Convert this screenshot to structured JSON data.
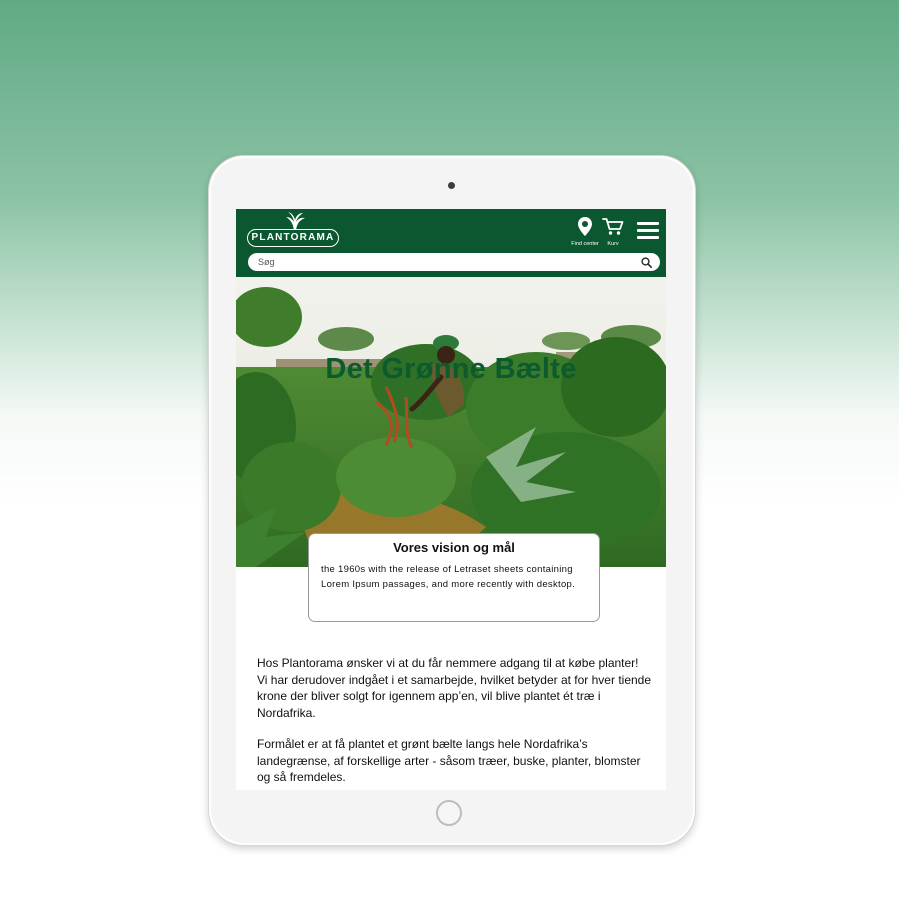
{
  "app": {
    "logo_text": "PLANTORAMA"
  },
  "header": {
    "find_center_label": "Find center",
    "cart_label": "Kurv",
    "search_placeholder": "Søg"
  },
  "hero": {
    "title": "Det Grønne Bælte"
  },
  "vision_card": {
    "title": "Vores vision og mål",
    "text": "the 1960s with the release of Letraset sheets containing Lorem Ipsum passages, and more recently with desktop."
  },
  "body": {
    "paragraphs": [
      "Hos Plantorama ønsker vi at du får nemmere adgang til at købe planter! Vi har derudover indgået i et samarbejde, hvilket betyder at for hver tiende krone der bliver solgt for igennem app’en, vil blive plantet ét træ i Nordafrika.",
      "Formålet er at få plantet et grønt bælte langs hele Nordafrika’s landegrænse, af forskellige arter - såsom træer, buske, planter, blomster og så fremdeles."
    ]
  },
  "colors": {
    "brand_green": "#0b5830",
    "title_green": "#0c5a2e",
    "background_gradient_top": "#60aa84"
  },
  "icons": [
    "location-pin-icon",
    "shopping-cart-icon",
    "hamburger-menu-icon",
    "search-icon",
    "palm-leaf-logo-icon",
    "camera-icon",
    "home-button"
  ]
}
